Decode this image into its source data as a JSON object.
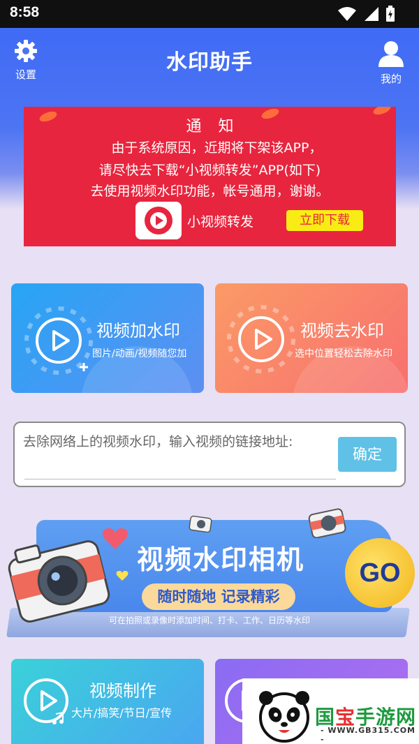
{
  "status_bar": {
    "time": "8:58"
  },
  "header": {
    "title": "水印助手",
    "settings_label": "设置",
    "profile_label": "我的"
  },
  "notice": {
    "title": "通知",
    "lines": [
      "由于系统原因，近期将下架该APP，",
      "请尽快去下载“小视频转发”APP(如下)",
      "去使用视频水印功能，帐号通用，谢谢。"
    ],
    "app_name": "小视频转发",
    "download_label": "立即下载"
  },
  "cards": {
    "add": {
      "title": "视频加水印",
      "subtitle": "图片/动画/视频随您加"
    },
    "remove": {
      "title": "视频去水印",
      "subtitle": "选中位置轻松去除水印"
    }
  },
  "url_input": {
    "placeholder": "去除网络上的视频水印，输入视频的链接地址:",
    "confirm_label": "确定"
  },
  "camera_banner": {
    "title": "视频水印相机",
    "pill": "随时随地 记录精彩",
    "subtitle": "可在拍照或录像时添加时间、打卡、工作、日历等水印",
    "go_label": "GO"
  },
  "bottom_cards": {
    "make": {
      "title": "视频制作",
      "subtitle": "大片/搞笑/节日/宣传"
    }
  },
  "watermark": {
    "name_green": "国",
    "name_red": "宝",
    "name_rest": "手游网",
    "url": "- WWW.GB315.COM -"
  },
  "colors": {
    "header_blue": "#3f6bf5",
    "notice_red": "#e8253e",
    "download_yellow": "#f9ec14",
    "confirm_blue": "#5fc1e6"
  },
  "icons": [
    "wifi-icon",
    "signal-icon",
    "battery-icon",
    "gear-icon",
    "user-icon",
    "play-circle-icon",
    "music-note-icon",
    "camera-icon",
    "heart-icon"
  ]
}
